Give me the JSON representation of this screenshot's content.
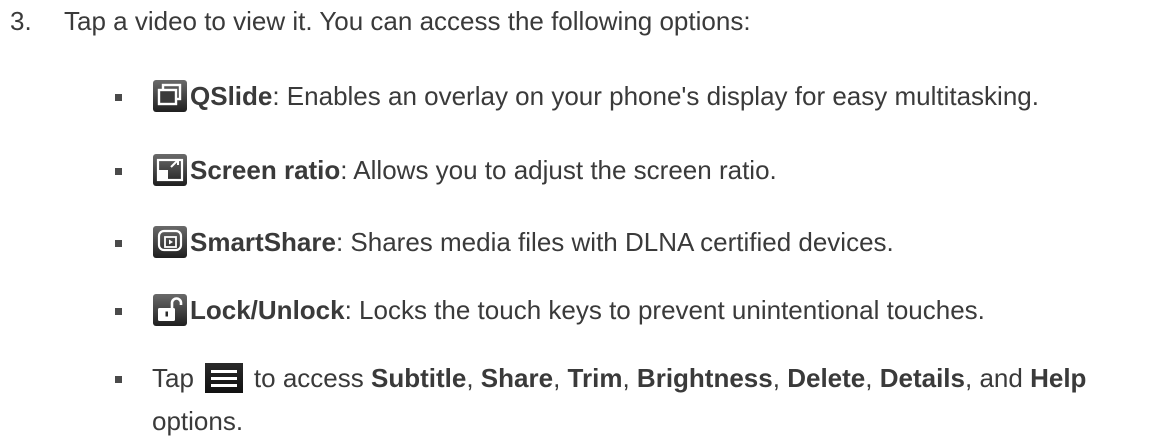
{
  "step": {
    "number": "3.",
    "text": "Tap a video to view it. You can access the following options:"
  },
  "options": [
    {
      "icon": "qslide-icon",
      "term": "QSlide",
      "desc": ": Enables an overlay on your phone's display for easy multitasking."
    },
    {
      "icon": "screen-ratio-icon",
      "term": "Screen ratio",
      "desc": ": Allows you to adjust the screen ratio."
    },
    {
      "icon": "smartshare-icon",
      "term": "SmartShare",
      "desc": ": Shares media files with DLNA certified devices."
    },
    {
      "icon": "lock-unlock-icon",
      "term": "Lock/Unlock",
      "desc": ": Locks the touch keys to prevent unintentional touches."
    }
  ],
  "menu_line": {
    "tap": "Tap",
    "icon": "menu-icon",
    "to_access": "to access",
    "items": [
      "Subtitle",
      "Share",
      "Trim",
      "Brightness",
      "Delete",
      "Details"
    ],
    "sep": ",",
    "and": "and",
    "last": "Help",
    "continuation": "options."
  }
}
